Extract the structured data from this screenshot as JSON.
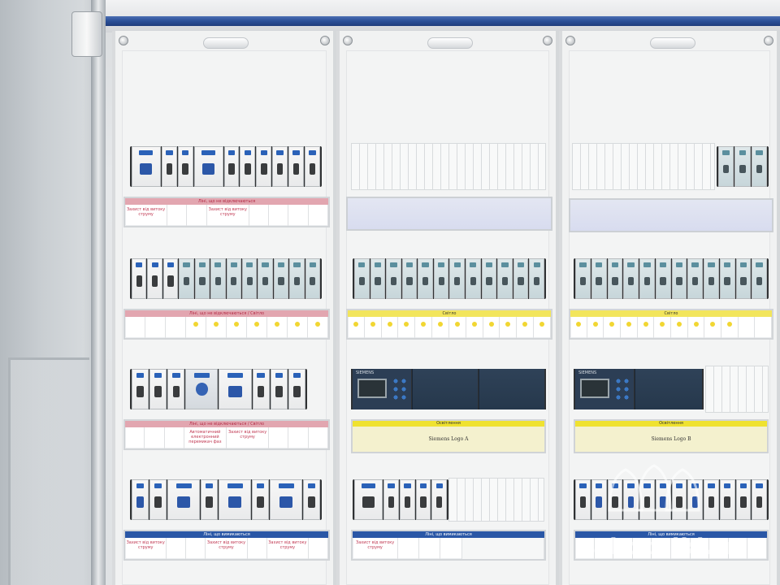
{
  "image": {
    "kind": "photograph",
    "subject": "electrical distribution cabinet"
  },
  "strips": {
    "col1_row1": {
      "title": "Ліні, що не відключаються",
      "cells": [
        "Захист від витоку струму",
        "Захист від витоку струму",
        "",
        "",
        "",
        "",
        "",
        ""
      ]
    },
    "col1_row2": {
      "title": "Ліні, що не відключаються / Світло",
      "cells": [
        "",
        "",
        "",
        "",
        "",
        "",
        "",
        "",
        ""
      ]
    },
    "col1_row3": {
      "title": "Ліні, що не відключаються / Світло",
      "cells": [
        "Автоматичний електронний перемикач фаз",
        "Захист від витоку струму"
      ]
    },
    "col1_row4": {
      "title": "Ліні, що вимикаються",
      "cells": [
        "Захист від витоку струму",
        "Захист від витоку струму",
        "Захист від витоку струму"
      ]
    },
    "col2_row1": {
      "title": "Світло"
    },
    "col2_row2": {
      "title": "Освітлення",
      "text": "Siemens Logo A"
    },
    "col2_row3": {
      "title": "Ліні, що вимикаються",
      "cells": [
        "Захист від витоку струму"
      ]
    },
    "col3_row1": {
      "title": "Світло"
    },
    "col3_row2": {
      "title": "Освітлення",
      "text": "Siemens Logo B"
    },
    "col3_row3": {
      "title": "Ліні, що вимикаються"
    }
  },
  "logo_devices": {
    "brand": "SIEMENS",
    "model": "LOGO!"
  },
  "watermark": "rabotniki.ua",
  "colors": {
    "rail": "#2f3133",
    "accent_blue": "#2a57a6",
    "label_yellow": "#efe22f",
    "label_red": "#e2a6b0"
  }
}
